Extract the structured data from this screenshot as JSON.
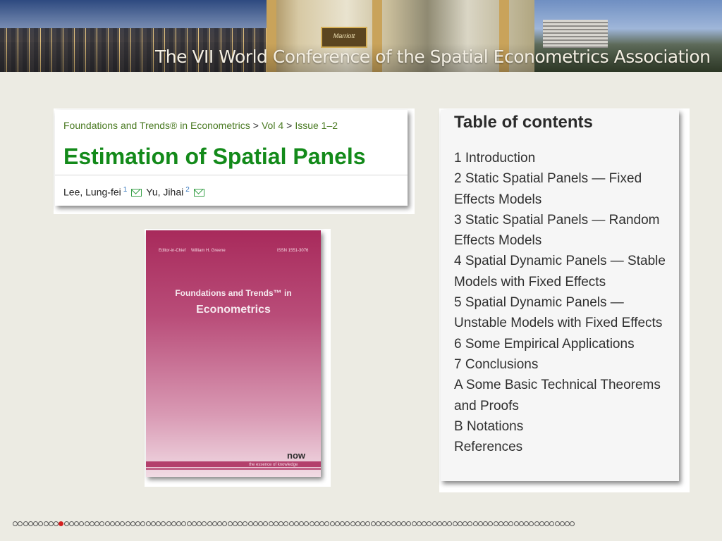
{
  "banner": {
    "title": "The VII World Conference of the Spatial Econometrics Association",
    "podium_sign": "Marriott"
  },
  "article": {
    "breadcrumb": [
      "Foundations and Trends® in Econometrics",
      "Vol 4",
      "Issue 1–2"
    ],
    "breadcrumb_separator": ">",
    "title": "Estimation of Spatial Panels",
    "authors": [
      {
        "name": "Lee, Lung-fei",
        "affiliation": "1"
      },
      {
        "name": "Yu, Jihai",
        "affiliation": "2"
      }
    ]
  },
  "cover": {
    "series_line1": "Foundations and Trends™ in",
    "series_line2": "Econometrics",
    "editor_label": "Editor-in-Chief",
    "editor_name": "William H. Greene",
    "issn": "ISSN 1551-3076",
    "publisher": "now",
    "publisher_tagline": "the essence of knowledge"
  },
  "toc": {
    "heading": "Table of contents",
    "items": [
      "1 Introduction",
      "2 Static Spatial Panels — Fixed Effects Models",
      "3 Static Spatial Panels — Random Effects Models",
      "4 Spatial Dynamic Panels — Stable Models with Fixed Effects",
      "5 Spatial Dynamic Panels — Unstable Models with Fixed Effects",
      "6 Some Empirical Applications",
      "7 Conclusions",
      "A Some Basic Technical Theorems and Proofs",
      "B Notations",
      "References"
    ]
  },
  "navigation": {
    "slide_count": 110,
    "current_slide": 10,
    "active_color": "#d42020"
  },
  "colors": {
    "background": "#ecebe3",
    "title_green": "#138a1a",
    "breadcrumb_green": "#4a7a22"
  }
}
